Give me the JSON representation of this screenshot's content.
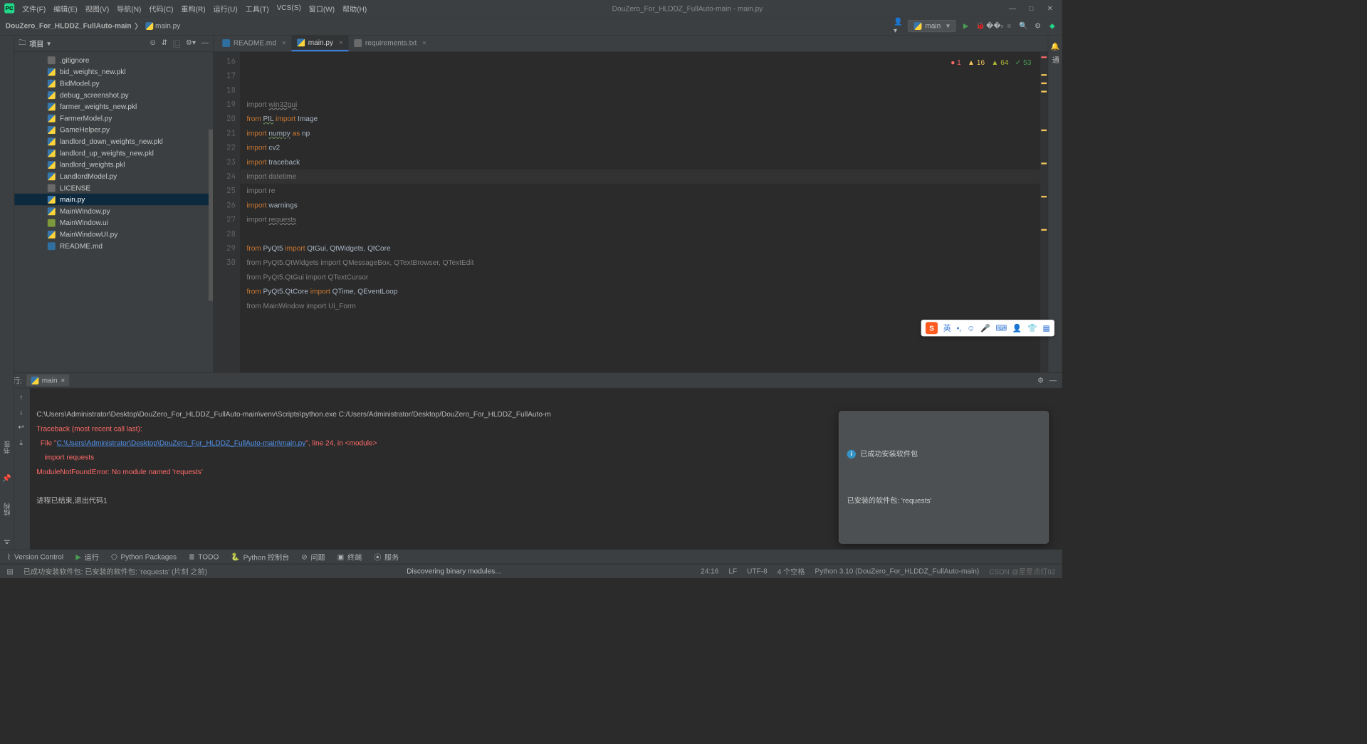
{
  "window": {
    "title": "DouZero_For_HLDDZ_FullAuto-main - main.py",
    "menus": [
      "文件(F)",
      "编辑(E)",
      "视图(V)",
      "导航(N)",
      "代码(C)",
      "重构(R)",
      "运行(U)",
      "工具(T)",
      "VCS(S)",
      "窗口(W)",
      "帮助(H)"
    ]
  },
  "breadcrumb": {
    "project": "DouZero_For_HLDDZ_FullAuto-main",
    "file": "main.py"
  },
  "runconfig": "main",
  "leftTabs": {
    "project": "项目",
    "bookmarks": "书签",
    "structure": "结构"
  },
  "sidebar": {
    "title": "项目",
    "items": [
      {
        "name": ".gitignore",
        "icon": "fi-txt"
      },
      {
        "name": "bid_weights_new.pkl",
        "icon": "fi-py"
      },
      {
        "name": "BidModel.py",
        "icon": "fi-py"
      },
      {
        "name": "debug_screenshot.py",
        "icon": "fi-py"
      },
      {
        "name": "farmer_weights_new.pkl",
        "icon": "fi-py"
      },
      {
        "name": "FarmerModel.py",
        "icon": "fi-py"
      },
      {
        "name": "GameHelper.py",
        "icon": "fi-py"
      },
      {
        "name": "landlord_down_weights_new.pkl",
        "icon": "fi-py"
      },
      {
        "name": "landlord_up_weights_new.pkl",
        "icon": "fi-py"
      },
      {
        "name": "landlord_weights.pkl",
        "icon": "fi-py"
      },
      {
        "name": "LandlordModel.py",
        "icon": "fi-py"
      },
      {
        "name": "LICENSE",
        "icon": "fi-txt"
      },
      {
        "name": "main.py",
        "icon": "fi-py",
        "sel": true
      },
      {
        "name": "MainWindow.py",
        "icon": "fi-py"
      },
      {
        "name": "MainWindow.ui",
        "icon": "fi-ui"
      },
      {
        "name": "MainWindowUI.py",
        "icon": "fi-py"
      },
      {
        "name": "README.md",
        "icon": "fi-md"
      }
    ]
  },
  "tabs": [
    {
      "label": "README.md",
      "icon": "fi-md"
    },
    {
      "label": "main.py",
      "icon": "fi-py",
      "active": true
    },
    {
      "label": "requirements.txt",
      "icon": "fi-txt"
    }
  ],
  "inspections": {
    "errors": "1",
    "warnings": "16",
    "weak": "64",
    "typos": "53"
  },
  "code": {
    "start": 16,
    "caretLine": 24,
    "lines": [
      {
        "n": 16,
        "html": "<span class='kw dim'>import</span> <span class='dim wavy'>win32gui</span>"
      },
      {
        "n": 17,
        "html": "<span class='kw'>from</span> <span class='wavy-g'>PIL</span> <span class='kw'>import</span> Image"
      },
      {
        "n": 18,
        "html": "<span class='kw'>import</span> <span class='wavy-g'>numpy</span> <span class='kw'>as</span> np"
      },
      {
        "n": 19,
        "html": "<span class='kw'>import</span> cv2"
      },
      {
        "n": 20,
        "html": "<span class='kw'>import</span> traceback"
      },
      {
        "n": 21,
        "html": "<span class='kw dim'>import</span> <span class='dim'>datetime</span>"
      },
      {
        "n": 22,
        "html": "<span class='kw dim'>import</span> <span class='dim'>re</span>"
      },
      {
        "n": 23,
        "html": "<span class='kw'>import</span> warnings"
      },
      {
        "n": 24,
        "html": "<span class='kw dim'>import</span> <span class='dim wavy'>requests</span>"
      },
      {
        "n": 25,
        "html": ""
      },
      {
        "n": 26,
        "html": "<span class='kw'>from</span> PyQt5 <span class='kw'>import</span> QtGui, QtWidgets, QtCore"
      },
      {
        "n": 27,
        "html": "<span class='kw dim'>from</span> <span class='dim'>PyQt5.QtWidgets</span> <span class='kw dim'>import</span> <span class='dim'>QMessageBox, QTextBrowser, QTextEdit</span>"
      },
      {
        "n": 28,
        "html": "<span class='kw dim'>from</span> <span class='dim'>PyQt5.QtGui</span> <span class='kw dim'>import</span> <span class='dim'>QTextCursor</span>"
      },
      {
        "n": 29,
        "html": "<span class='kw'>from</span> PyQt5.QtCore <span class='kw'>import</span> QTime, QEventLoop"
      },
      {
        "n": 30,
        "html": "<span class='kw dim'>from</span> <span class='dim'>MainWindow</span> <span class='kw dim'>import</span> <span class='dim'>Ui_Form</span>"
      }
    ]
  },
  "run": {
    "label": "运行:",
    "tab": "main",
    "cmd": "C:\\Users\\Administrator\\Desktop\\DouZero_For_HLDDZ_FullAuto-main\\venv\\Scripts\\python.exe C:/Users/Administrator/Desktop/DouZero_For_HLDDZ_FullAuto-m",
    "tb1": "Traceback (most recent call last):",
    "file_pre": "  File \"",
    "file_link": "C:\\Users\\Administrator\\Desktop\\DouZero_For_HLDDZ_FullAuto-main\\main.py",
    "file_post": "\", line 24, in <module>",
    "tb3": "    import requests",
    "tb4": "ModuleNotFoundError: No module named 'requests'",
    "exit": "进程已结束,退出代码1"
  },
  "notif": {
    "title": "已成功安装软件包",
    "body": "已安装的软件包: 'requests'"
  },
  "ime": {
    "lang": "英"
  },
  "bottom": {
    "items": [
      "Version Control",
      "运行",
      "Python Packages",
      "TODO",
      "Python 控制台",
      "问题",
      "终端",
      "服务"
    ]
  },
  "status": {
    "msg": "已成功安装软件包: 已安装的软件包: 'requests' (片刻 之前)",
    "progress": "Discovering binary modules...",
    "pos": "24:16",
    "eol": "LF",
    "enc": "UTF-8",
    "indent": "4 个空格",
    "interp": "Python 3.10 (DouZero_For_HLDDZ_FullAuto-main)",
    "watermark": "CSDN @星星点灯92"
  }
}
